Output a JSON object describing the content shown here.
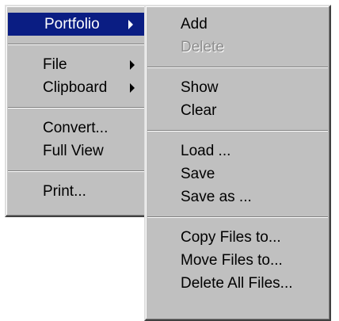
{
  "main_menu": {
    "items": [
      {
        "label": "Portfolio",
        "submenu": true,
        "selected": true
      },
      {
        "label": "File",
        "submenu": true
      },
      {
        "label": "Clipboard",
        "submenu": true
      },
      {
        "label": "Convert..."
      },
      {
        "label": "Full View"
      },
      {
        "label": "Print..."
      }
    ],
    "highlight_color": "#0a1d83"
  },
  "portfolio_submenu": {
    "items": [
      {
        "label": "Add"
      },
      {
        "label": "Delete",
        "disabled": true
      },
      {
        "label": "Show"
      },
      {
        "label": "Clear"
      },
      {
        "label": "Load ..."
      },
      {
        "label": "Save"
      },
      {
        "label": "Save as ..."
      },
      {
        "label": "Copy Files to..."
      },
      {
        "label": "Move Files to..."
      },
      {
        "label": "Delete All Files..."
      }
    ]
  }
}
